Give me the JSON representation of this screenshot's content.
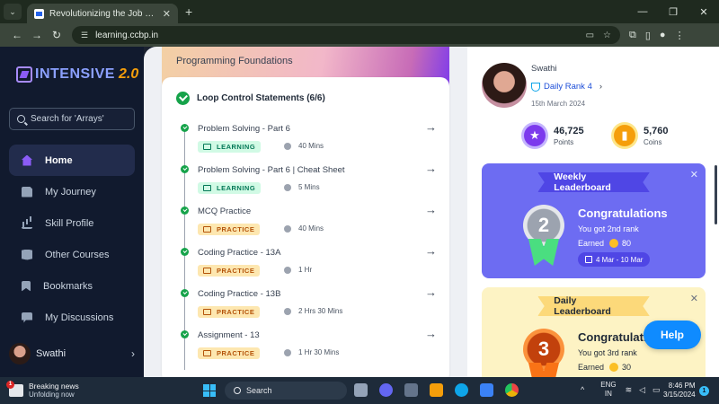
{
  "browser": {
    "tab_title": "Revolutionizing the Job Market",
    "url": "learning.ccbp.in"
  },
  "sidebar": {
    "logo_text": "INTENSIVE",
    "logo_version": "2.0",
    "search_placeholder": "Search for 'Arrays'",
    "items": [
      {
        "label": "Home"
      },
      {
        "label": "My Journey"
      },
      {
        "label": "Skill Profile"
      },
      {
        "label": "Other Courses"
      },
      {
        "label": "Bookmarks"
      },
      {
        "label": "My Discussions"
      }
    ],
    "user_name": "Swathi"
  },
  "main": {
    "hero_title": "Programming Foundations",
    "section_title": "Loop Control Statements (6/6)",
    "items": [
      {
        "name": "Problem Solving - Part 6",
        "badge": "LEARNING",
        "duration": "40 Mins"
      },
      {
        "name": "Problem Solving - Part 6 | Cheat Sheet",
        "badge": "LEARNING",
        "duration": "5 Mins"
      },
      {
        "name": "MCQ Practice",
        "badge": "PRACTICE",
        "duration": "40 Mins"
      },
      {
        "name": "Coding Practice - 13A",
        "badge": "PRACTICE",
        "duration": "1 Hr"
      },
      {
        "name": "Coding Practice - 13B",
        "badge": "PRACTICE",
        "duration": "2 Hrs 30 Mins"
      },
      {
        "name": "Assignment - 13",
        "badge": "PRACTICE",
        "duration": "1 Hr 30 Mins"
      }
    ]
  },
  "profile": {
    "name": "Swathi",
    "rank": "Daily Rank 4",
    "date": "15th March 2024",
    "points": "46,725",
    "points_label": "Points",
    "coins": "5,760",
    "coins_label": "Coins"
  },
  "weekly": {
    "title": "Weekly Leaderboard",
    "medal": "2",
    "congrats": "Congratulations",
    "message": "You got 2nd rank",
    "earned_label": "Earned",
    "earned_value": "80",
    "range": "4 Mar - 10 Mar"
  },
  "daily": {
    "title": "Daily Leaderboard",
    "medal": "3",
    "congrats": "Congratulations",
    "message": "You got 3rd rank",
    "earned_label": "Earned",
    "earned_value": "30"
  },
  "help_label": "Help",
  "taskbar": {
    "news_title": "Breaking news",
    "news_sub": "Unfolding now",
    "news_badge": "1",
    "search_label": "Search",
    "lang_1": "ENG",
    "lang_2": "IN",
    "time": "8:46 PM",
    "date": "3/15/2024",
    "notif_count": "1"
  },
  "colors": {
    "accent": "#8b5cf6",
    "success": "#16a34a",
    "weekly_bg": "#6d6cf2",
    "daily_bg": "#fdf3c4",
    "help_bg": "#0f8bff"
  }
}
